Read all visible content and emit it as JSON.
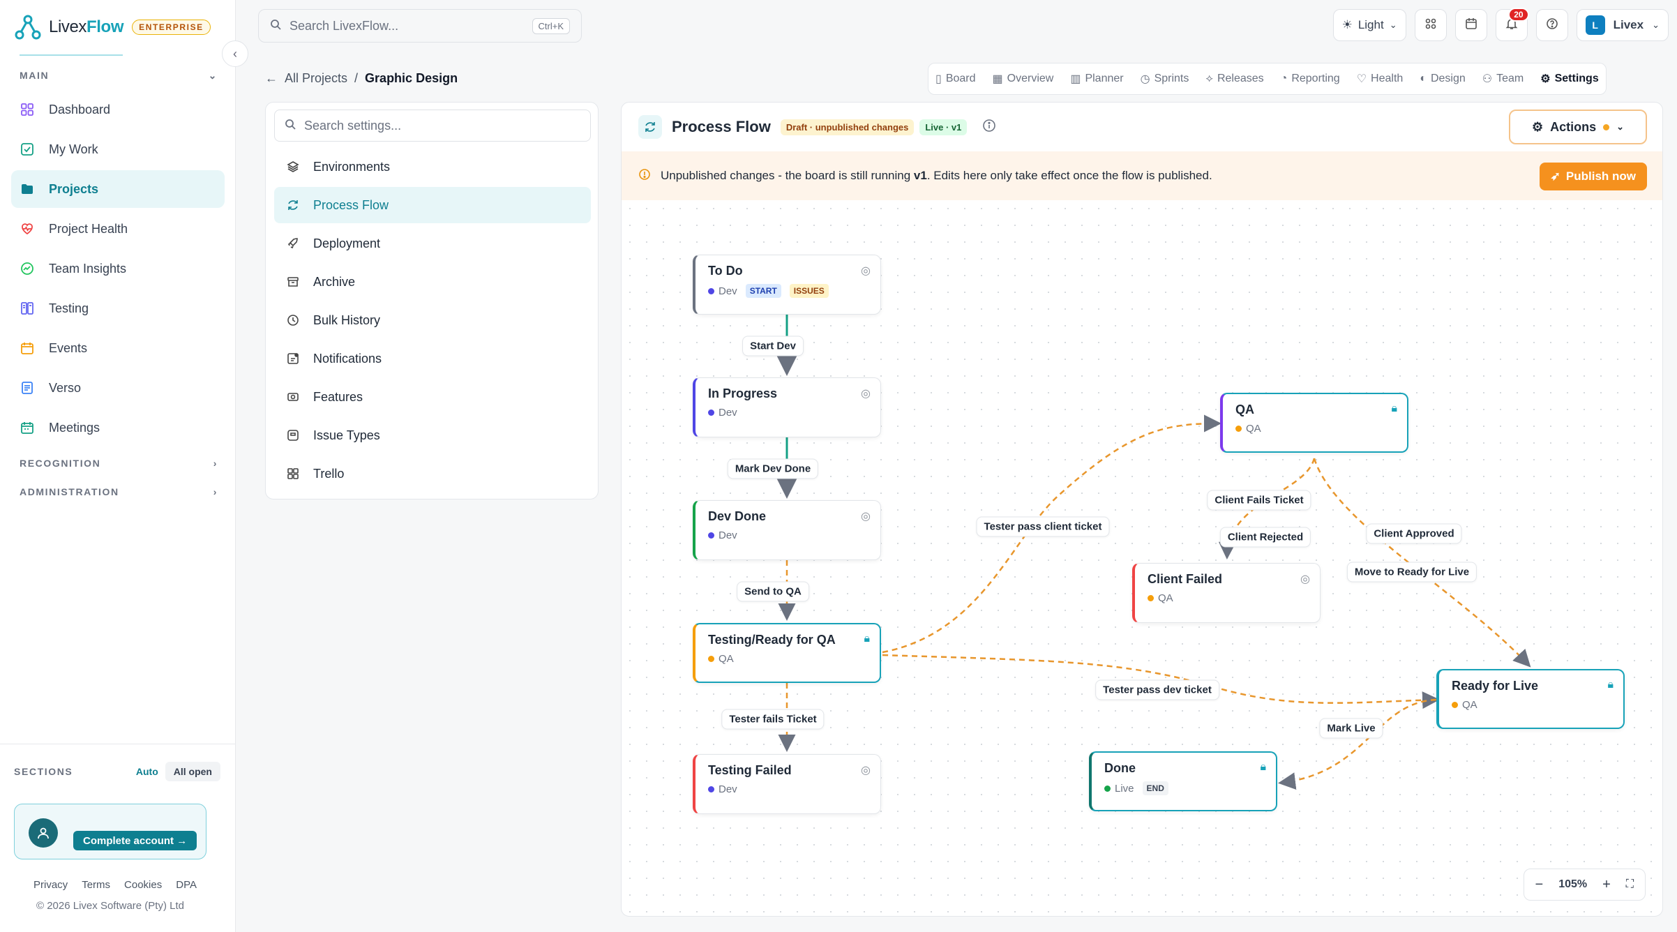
{
  "brand": {
    "name_a": "Livex",
    "name_b": "Flow",
    "badge": "ENTERPRISE"
  },
  "sidebar": {
    "main_heading": "MAIN",
    "items": [
      {
        "label": "Dashboard",
        "icon": "grid-icon"
      },
      {
        "label": "My Work",
        "icon": "check-square-icon"
      },
      {
        "label": "Projects",
        "icon": "folder-icon",
        "active": true
      },
      {
        "label": "Project Health",
        "icon": "heart-pulse-icon"
      },
      {
        "label": "Team Insights",
        "icon": "trend-icon"
      },
      {
        "label": "Testing",
        "icon": "columns-icon"
      },
      {
        "label": "Events",
        "icon": "calendar-icon"
      },
      {
        "label": "Verso",
        "icon": "document-icon"
      },
      {
        "label": "Meetings",
        "icon": "calendar-grid-icon"
      }
    ],
    "recognition": "RECOGNITION",
    "administration": "ADMINISTRATION",
    "sections_label": "SECTIONS",
    "sections_auto": "Auto",
    "sections_all": "All open",
    "complete_account": "Complete account",
    "footer_links": [
      "Privacy",
      "Terms",
      "Cookies",
      "DPA"
    ],
    "copyright": "© 2026 Livex Software (Pty) Ltd"
  },
  "topbar": {
    "search_placeholder": "Search LivexFlow...",
    "shortcut": "Ctrl+K",
    "theme": "Light",
    "notifications_count": "20",
    "user_initial": "L",
    "user_name": "Livex"
  },
  "breadcrumb": {
    "back": "All Projects",
    "sep": "/",
    "current": "Graphic Design"
  },
  "tabs": [
    {
      "label": "Board",
      "icon": "board-icon"
    },
    {
      "label": "Overview",
      "icon": "grid-icon"
    },
    {
      "label": "Planner",
      "icon": "bar-icon"
    },
    {
      "label": "Sprints",
      "icon": "clock-icon"
    },
    {
      "label": "Releases",
      "icon": "rocket-icon"
    },
    {
      "label": "Reporting",
      "icon": "pie-icon"
    },
    {
      "label": "Health",
      "icon": "heart-icon"
    },
    {
      "label": "Design",
      "icon": "palette-icon"
    },
    {
      "label": "Team",
      "icon": "team-icon"
    },
    {
      "label": "Settings",
      "icon": "gear-icon",
      "active": true
    }
  ],
  "settings_menu": {
    "search_placeholder": "Search settings...",
    "items": [
      {
        "label": "Environments",
        "icon": "layers-icon"
      },
      {
        "label": "Process Flow",
        "icon": "refresh-icon",
        "active": true
      },
      {
        "label": "Deployment",
        "icon": "rocket-icon"
      },
      {
        "label": "Archive",
        "icon": "archive-icon"
      },
      {
        "label": "Bulk History",
        "icon": "history-icon"
      },
      {
        "label": "Notifications",
        "icon": "bell-icon"
      },
      {
        "label": "Features",
        "icon": "toggle-icon"
      },
      {
        "label": "Issue Types",
        "icon": "tag-icon"
      },
      {
        "label": "Trello",
        "icon": "grid-icon"
      }
    ]
  },
  "flow": {
    "title": "Process Flow",
    "draft_pill": "Draft · unpublished changes",
    "live_pill": "Live · v1",
    "actions": "Actions",
    "banner_a": "Unpublished changes - the board is still running ",
    "banner_b": "v1",
    "banner_c": ". Edits here only take effect once the flow is published.",
    "publish": "Publish now",
    "zoom": "105%",
    "colors": {
      "dev": "#4f46e5",
      "qa": "#f59e0b",
      "live": "#16a34a",
      "edge_solid": "#14a085",
      "edge_dashed": "#e8962c"
    },
    "nodes": [
      {
        "id": "todo",
        "title": "To Do",
        "env": "Dev",
        "tags": [
          "START",
          "ISSUES"
        ],
        "icon": "fingerprint-icon"
      },
      {
        "id": "inprog",
        "title": "In Progress",
        "env": "Dev",
        "tags": [],
        "icon": "fingerprint-icon"
      },
      {
        "id": "devdone",
        "title": "Dev Done",
        "env": "Dev",
        "tags": [],
        "icon": "fingerprint-icon"
      },
      {
        "id": "testqa",
        "title": "Testing/Ready for QA",
        "env": "QA",
        "tags": [],
        "icon": "lock-icon"
      },
      {
        "id": "testfail",
        "title": "Testing Failed",
        "env": "Dev",
        "tags": [],
        "icon": "fingerprint-icon"
      },
      {
        "id": "qa",
        "title": "QA",
        "env": "QA",
        "tags": [],
        "icon": "lock-icon"
      },
      {
        "id": "clientfail",
        "title": "Client Failed",
        "env": "QA",
        "tags": [],
        "icon": "fingerprint-icon"
      },
      {
        "id": "readylive",
        "title": "Ready for Live",
        "env": "QA",
        "tags": [],
        "icon": "lock-icon"
      },
      {
        "id": "done",
        "title": "Done",
        "env": "Live",
        "tags": [
          "END"
        ],
        "icon": "lock-icon"
      }
    ],
    "edge_labels": [
      "Start Dev",
      "Mark Dev Done",
      "Send to QA",
      "Tester fails Ticket",
      "Tester pass client ticket",
      "Client Fails Ticket",
      "Client Rejected",
      "Client Approved",
      "Move to Ready for Live",
      "Tester pass dev ticket",
      "Mark Live"
    ]
  }
}
